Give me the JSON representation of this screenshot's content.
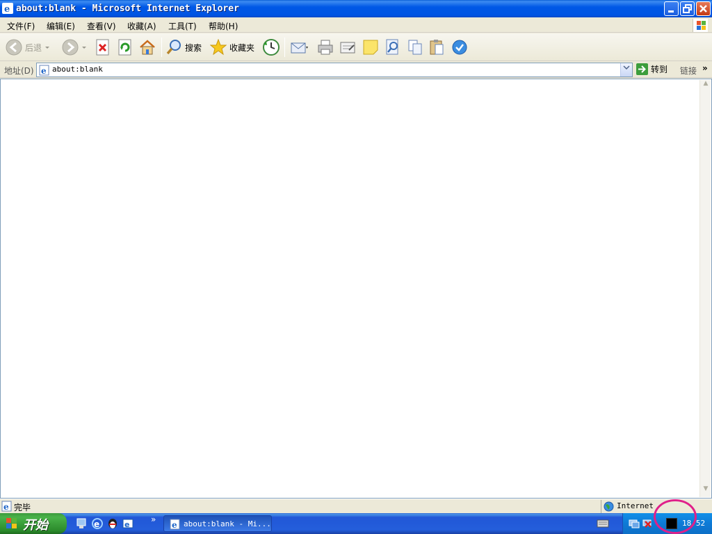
{
  "window": {
    "title": "about:blank - Microsoft Internet Explorer"
  },
  "menubar": {
    "items": [
      "文件(F)",
      "编辑(E)",
      "查看(V)",
      "收藏(A)",
      "工具(T)",
      "帮助(H)"
    ]
  },
  "toolbar": {
    "back_label": "后退",
    "search_label": "搜索",
    "favorites_label": "收藏夹"
  },
  "addressbar": {
    "label": "地址(D)",
    "url": "about:blank",
    "go_label": "转到",
    "links_label": "链接",
    "more": "»"
  },
  "statusbar": {
    "status": "完毕",
    "zone": "Internet"
  },
  "taskbar": {
    "start_label": "开始",
    "quicklaunch_more": "»",
    "task_label": "about:blank - Mi...",
    "clock": "18 52"
  },
  "colors": {
    "titlebar": "#0054e3",
    "taskbar": "#245edb",
    "start_button": "#3c9a3c",
    "annotation": "#e0208a"
  }
}
